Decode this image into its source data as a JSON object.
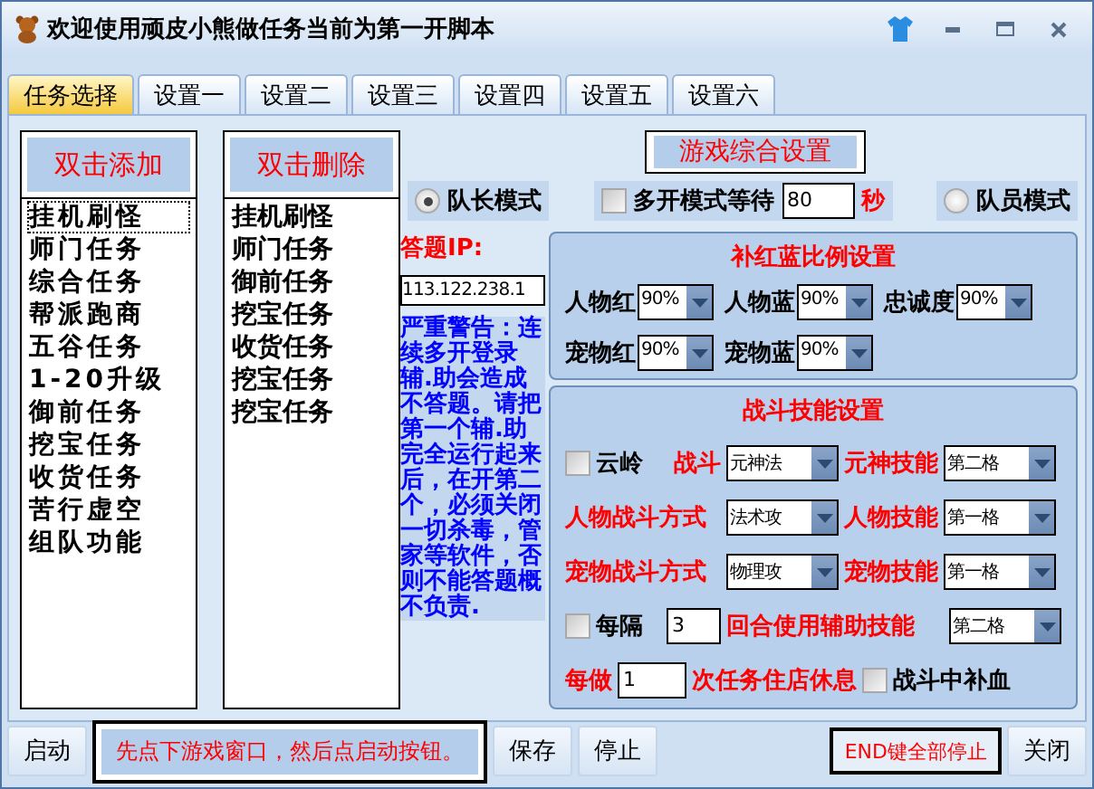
{
  "window": {
    "title": "欢迎使用顽皮小熊做任务当前为第一开脚本"
  },
  "tabs": [
    {
      "label": "任务选择",
      "selected": true
    },
    {
      "label": "设置一",
      "selected": false
    },
    {
      "label": "设置二",
      "selected": false
    },
    {
      "label": "设置三",
      "selected": false
    },
    {
      "label": "设置四",
      "selected": false
    },
    {
      "label": "设置五",
      "selected": false
    },
    {
      "label": "设置六",
      "selected": false
    }
  ],
  "add_list": {
    "header": "双击添加",
    "items": [
      {
        "label": "挂机刷怪",
        "selected": true
      },
      {
        "label": "师门任务",
        "selected": false
      },
      {
        "label": "综合任务",
        "selected": false
      },
      {
        "label": "帮派跑商",
        "selected": false
      },
      {
        "label": "五谷任务",
        "selected": false
      },
      {
        "label": "1-20升级",
        "selected": false
      },
      {
        "label": "御前任务",
        "selected": false
      },
      {
        "label": "挖宝任务",
        "selected": false
      },
      {
        "label": "收货任务",
        "selected": false
      },
      {
        "label": "苦行虚空",
        "selected": false
      },
      {
        "label": "组队功能",
        "selected": false
      }
    ]
  },
  "remove_list": {
    "header": "双击删除",
    "items": [
      {
        "label": "挂机刷怪"
      },
      {
        "label": "师门任务"
      },
      {
        "label": "御前任务"
      },
      {
        "label": "挖宝任务"
      },
      {
        "label": "收货任务"
      },
      {
        "label": "挖宝任务"
      },
      {
        "label": "挖宝任务"
      }
    ]
  },
  "general_settings": {
    "title": "游戏综合设置"
  },
  "modes": [
    {
      "kind": "radio",
      "label": "队长模式",
      "selected": true
    },
    {
      "kind": "wait",
      "label": "多开模式等待",
      "checked": false,
      "value": "80",
      "unit": "秒"
    },
    {
      "kind": "radio",
      "label": "队员模式",
      "selected": false
    }
  ],
  "answer_ip": {
    "label": "答题IP:",
    "value": "113.122.238.1"
  },
  "warning": "严重警告：连续多开登录辅.助会造成不答题。请把第一个辅.助完全运行起来后，在开第二个，必须关闭一切杀毒，管家等软件，否则不能答题概不负责.",
  "potion": {
    "title": "补红蓝比例设置",
    "fields": [
      {
        "label": "人物红",
        "value": "90%"
      },
      {
        "label": "人物蓝",
        "value": "90%"
      },
      {
        "label": "忠诚度",
        "value": "90%"
      },
      {
        "label": "宠物红",
        "value": "90%"
      },
      {
        "label": "宠物蓝",
        "value": "90%"
      }
    ]
  },
  "combat": {
    "title": "战斗技能设置",
    "rows": [
      {
        "kind": "fight",
        "checkbox": {
          "label": "云岭",
          "checked": false
        },
        "label": "战斗",
        "mode": "元神法",
        "skill_label": "元神技能",
        "skill": "第二格"
      },
      {
        "kind": "fight",
        "label": "人物战斗方式",
        "mode": "法术攻",
        "skill_label": "人物技能",
        "skill": "第一格"
      },
      {
        "kind": "fight",
        "label": "宠物战斗方式",
        "mode": "物理攻",
        "skill_label": "宠物技能",
        "skill": "第一格"
      },
      {
        "kind": "interval",
        "label": "每隔",
        "checked": false,
        "value": "3",
        "text": "回合使用辅助技能",
        "skill": "第二格"
      },
      {
        "kind": "rest",
        "label": "每做",
        "value": "1",
        "text": "次任务住店休息",
        "checkbox": {
          "label": "战斗中补血",
          "checked": false
        }
      }
    ]
  },
  "footer": {
    "left": [
      {
        "kind": "button",
        "label": "启动"
      },
      {
        "kind": "message",
        "text": "先点下游戏窗口，然后点启动按钮。"
      },
      {
        "kind": "button",
        "label": "保存"
      },
      {
        "kind": "button",
        "label": "停止"
      }
    ],
    "right": [
      {
        "kind": "outlined",
        "label": "END键全部停止"
      },
      {
        "kind": "button",
        "label": "关闭"
      }
    ]
  }
}
